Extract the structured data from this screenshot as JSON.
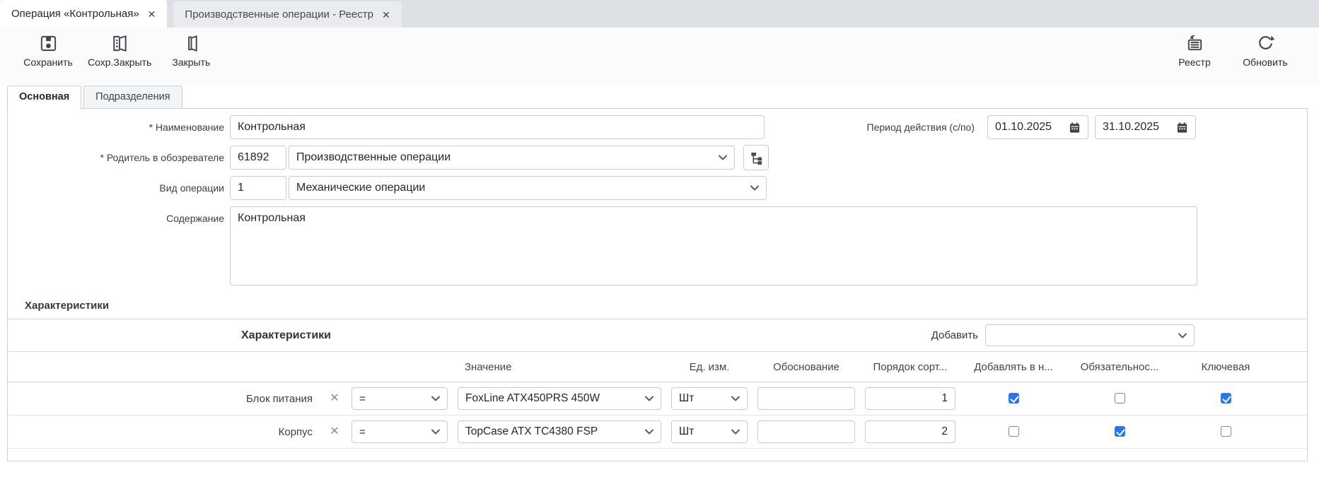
{
  "tabs": [
    {
      "label": "Операция «Контрольная»",
      "active": true
    },
    {
      "label": "Производственные операции - Реестр",
      "active": false
    }
  ],
  "toolbar": {
    "save_label": "Сохранить",
    "save_close_label": "Сохр.Закрыть",
    "close_label": "Закрыть",
    "registry_label": "Реестр",
    "refresh_label": "Обновить"
  },
  "subtabs": [
    {
      "label": "Основная",
      "active": true
    },
    {
      "label": "Подразделения",
      "active": false
    }
  ],
  "form": {
    "name": {
      "label": "* Наименование",
      "value": "Контрольная"
    },
    "period": {
      "label": "Период действия (с/по)",
      "from": "01.10.2025",
      "to": "31.10.2025"
    },
    "parent": {
      "label": "* Родитель в обозревателе",
      "code": "61892",
      "value": "Производственные операции"
    },
    "operation_kind": {
      "label": "Вид операции",
      "code": "1",
      "value": "Механические операции"
    },
    "content": {
      "label": "Содержание",
      "value": "Контрольная"
    }
  },
  "characteristics": {
    "section_title": "Характеристики",
    "table_title": "Характеристики",
    "add_label": "Добавить",
    "add_value": "",
    "columns": [
      "Значение",
      "Ед. изм.",
      "Обоснование",
      "Порядок сорт...",
      "Добавлять в н...",
      "Обязательнос...",
      "Ключевая"
    ],
    "rows": [
      {
        "name": "Блок питания",
        "condition": "=",
        "value": "FoxLine ATX450PRS 450W",
        "unit": "Шт",
        "justification": "",
        "sort_order": "1",
        "add_to_new": true,
        "required": false,
        "key": true
      },
      {
        "name": "Корпус",
        "condition": "=",
        "value": "TopCase ATX TC4380 FSP",
        "unit": "Шт",
        "justification": "",
        "sort_order": "2",
        "add_to_new": false,
        "required": true,
        "key": false
      }
    ]
  },
  "colors": {
    "checkbox_checked": "#2878e8",
    "tabbar_bg": "#dde0e5",
    "panel_border": "#ccd1d7"
  }
}
